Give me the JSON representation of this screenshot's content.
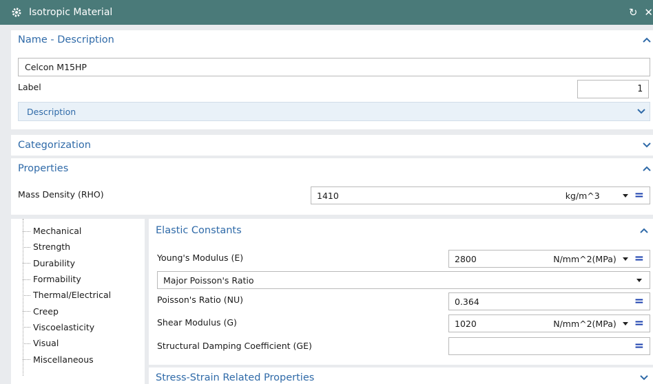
{
  "window": {
    "title": "Isotropic Material",
    "reset_icon": "reset-icon",
    "close_icon": "close-icon"
  },
  "name_section": {
    "header": "Name - Description",
    "name_value": "Celcon M15HP",
    "label_label": "Label",
    "label_value": "1",
    "description_label": "Description"
  },
  "categorization": {
    "header": "Categorization"
  },
  "properties": {
    "header": "Properties",
    "mass_density": {
      "label": "Mass Density (RHO)",
      "value": "1410",
      "unit": "kg/m^3"
    }
  },
  "tree": {
    "items": [
      "Mechanical",
      "Strength",
      "Durability",
      "Formability",
      "Thermal/Electrical",
      "Creep",
      "Viscoelasticity",
      "Visual",
      "Miscellaneous"
    ]
  },
  "elastic": {
    "header": "Elastic Constants",
    "youngs": {
      "label": "Young's Modulus (E)",
      "value": "2800",
      "unit": "N/mm^2(MPa)"
    },
    "poisson_select": "Major Poisson's Ratio",
    "poisson": {
      "label": "Poisson's Ratio (NU)",
      "value": "0.364"
    },
    "shear": {
      "label": "Shear Modulus (G)",
      "value": "1020",
      "unit": "N/mm^2(MPa)"
    },
    "damping": {
      "label": "Structural Damping Coefficient (GE)",
      "value": ""
    }
  },
  "stress": {
    "header": "Stress-Strain Related Properties"
  },
  "colors": {
    "titlebar": "#4a7a79",
    "section_header": "#2f6aa8",
    "equals": "#1a3fae"
  }
}
